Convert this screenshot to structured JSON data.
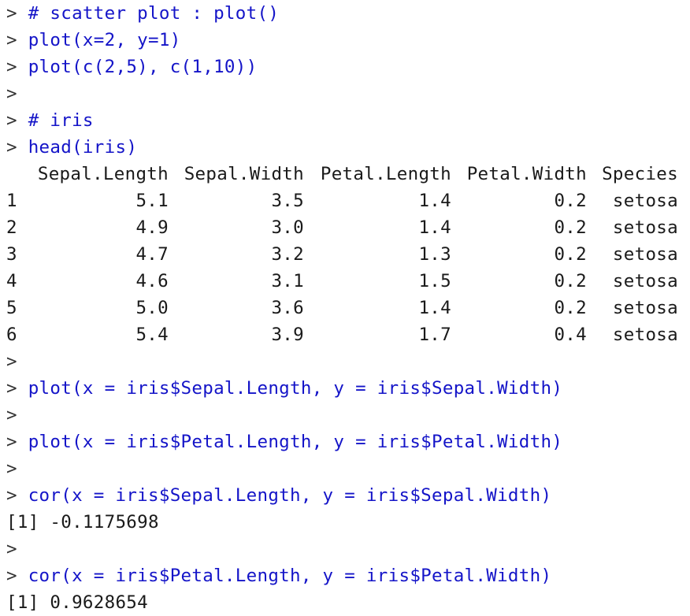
{
  "console": {
    "prompt": "> ",
    "lines_before": [
      {
        "type": "cmd",
        "text": "# scatter plot : plot()"
      },
      {
        "type": "cmd",
        "text": "plot(x=2, y=1)"
      },
      {
        "type": "cmd",
        "text": "plot(c(2,5), c(1,10))"
      },
      {
        "type": "cmd",
        "text": ""
      },
      {
        "type": "cmd",
        "text": "# iris"
      },
      {
        "type": "cmd",
        "text": "head(iris)"
      }
    ],
    "table": {
      "headers": [
        "Sepal.Length",
        "Sepal.Width",
        "Petal.Length",
        "Petal.Width",
        "Species"
      ],
      "rows": [
        {
          "name": "1",
          "cells": [
            "5.1",
            "3.5",
            "1.4",
            "0.2",
            "setosa"
          ]
        },
        {
          "name": "2",
          "cells": [
            "4.9",
            "3.0",
            "1.4",
            "0.2",
            "setosa"
          ]
        },
        {
          "name": "3",
          "cells": [
            "4.7",
            "3.2",
            "1.3",
            "0.2",
            "setosa"
          ]
        },
        {
          "name": "4",
          "cells": [
            "4.6",
            "3.1",
            "1.5",
            "0.2",
            "setosa"
          ]
        },
        {
          "name": "5",
          "cells": [
            "5.0",
            "3.6",
            "1.4",
            "0.2",
            "setosa"
          ]
        },
        {
          "name": "6",
          "cells": [
            "5.4",
            "3.9",
            "1.7",
            "0.4",
            "setosa"
          ]
        }
      ]
    },
    "lines_after": [
      {
        "type": "cmd",
        "text": ""
      },
      {
        "type": "cmd",
        "text": "plot(x = iris$Sepal.Length, y = iris$Sepal.Width)"
      },
      {
        "type": "cmd",
        "text": ""
      },
      {
        "type": "cmd",
        "text": "plot(x = iris$Petal.Length, y = iris$Petal.Width)"
      },
      {
        "type": "cmd",
        "text": ""
      },
      {
        "type": "cmd",
        "text": "cor(x = iris$Sepal.Length, y = iris$Sepal.Width)"
      },
      {
        "type": "out",
        "text": "[1] -0.1175698"
      },
      {
        "type": "cmd",
        "text": ""
      },
      {
        "type": "cmd",
        "text": "cor(x = iris$Petal.Length, y = iris$Petal.Width)"
      },
      {
        "type": "out",
        "text": "[1] 0.9628654"
      }
    ]
  },
  "colors": {
    "command": "#1414c8",
    "prompt": "#333333",
    "output": "#1a1a1a",
    "background": "#ffffff"
  }
}
